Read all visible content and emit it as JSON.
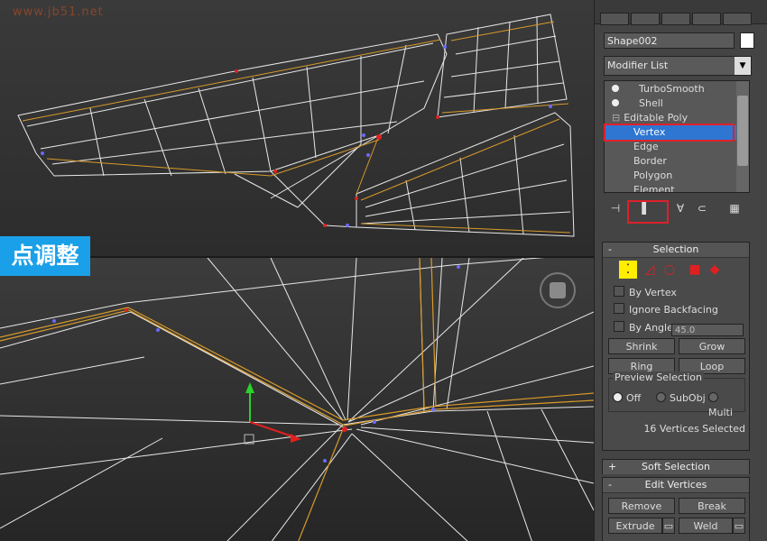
{
  "watermark": "www.jb51.net",
  "badge_label": "点调整",
  "panel": {
    "object_name": "Shape002",
    "object_color": "#ffffff",
    "modifier_list_label": "Modifier List",
    "stack": [
      {
        "label": "TurboSmooth",
        "type": "modifier"
      },
      {
        "label": "Shell",
        "type": "modifier"
      },
      {
        "label": "Editable Poly",
        "type": "base"
      },
      {
        "label": "Vertex",
        "type": "sub",
        "selected": true
      },
      {
        "label": "Edge",
        "type": "sub"
      },
      {
        "label": "Border",
        "type": "sub"
      },
      {
        "label": "Polygon",
        "type": "sub"
      },
      {
        "label": "Element",
        "type": "sub"
      }
    ],
    "selection": {
      "title": "Selection",
      "by_vertex": "By Vertex",
      "ignore_backfacing": "Ignore Backfacing",
      "by_angle": "By Angle:",
      "angle_value": "45.0",
      "shrink": "Shrink",
      "grow": "Grow",
      "ring": "Ring",
      "loop": "Loop",
      "preview_title": "Preview Selection",
      "preview_off": "Off",
      "preview_subobj": "SubObj",
      "preview_multi": "Multi",
      "status": "16 Vertices Selected"
    },
    "soft_selection": {
      "title": "Soft Selection"
    },
    "edit_vertices": {
      "title": "Edit Vertices",
      "remove": "Remove",
      "break": "Break",
      "extrude": "Extrude",
      "weld": "Weld"
    }
  },
  "colors": {
    "accent_highlight": "#e0202a",
    "badge": "#1aa0e8",
    "stack_selected": "#2f76d2",
    "wire": "#ffffff",
    "edge_selected": "#d89a2a"
  }
}
